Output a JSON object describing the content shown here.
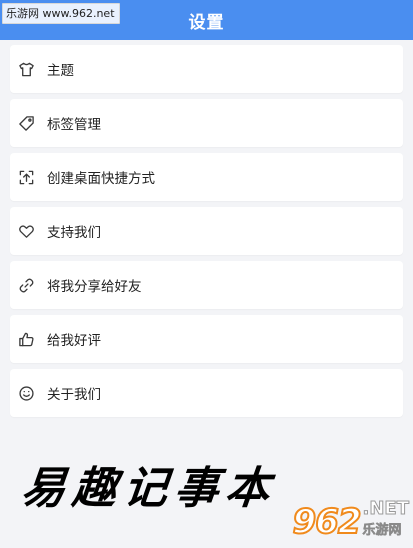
{
  "header": {
    "title": "设置",
    "bg_color": "#4a8ef0"
  },
  "watermark_top": {
    "text": "乐游网 www.962.net"
  },
  "settings": {
    "items": [
      {
        "label": "主题",
        "icon": "tshirt-icon"
      },
      {
        "label": "标签管理",
        "icon": "tag-icon"
      },
      {
        "label": "创建桌面快捷方式",
        "icon": "shortcut-upload-icon"
      },
      {
        "label": "支持我们",
        "icon": "heart-icon"
      },
      {
        "label": "将我分享给好友",
        "icon": "link-icon"
      },
      {
        "label": "给我好评",
        "icon": "thumbs-up-icon"
      },
      {
        "label": "关于我们",
        "icon": "smiley-icon"
      }
    ]
  },
  "brush_text": "易趣记事本",
  "watermark_bottom": {
    "logo": "962",
    "net": ".NET",
    "cn": "乐游网",
    "accent": "#f08a1c"
  }
}
